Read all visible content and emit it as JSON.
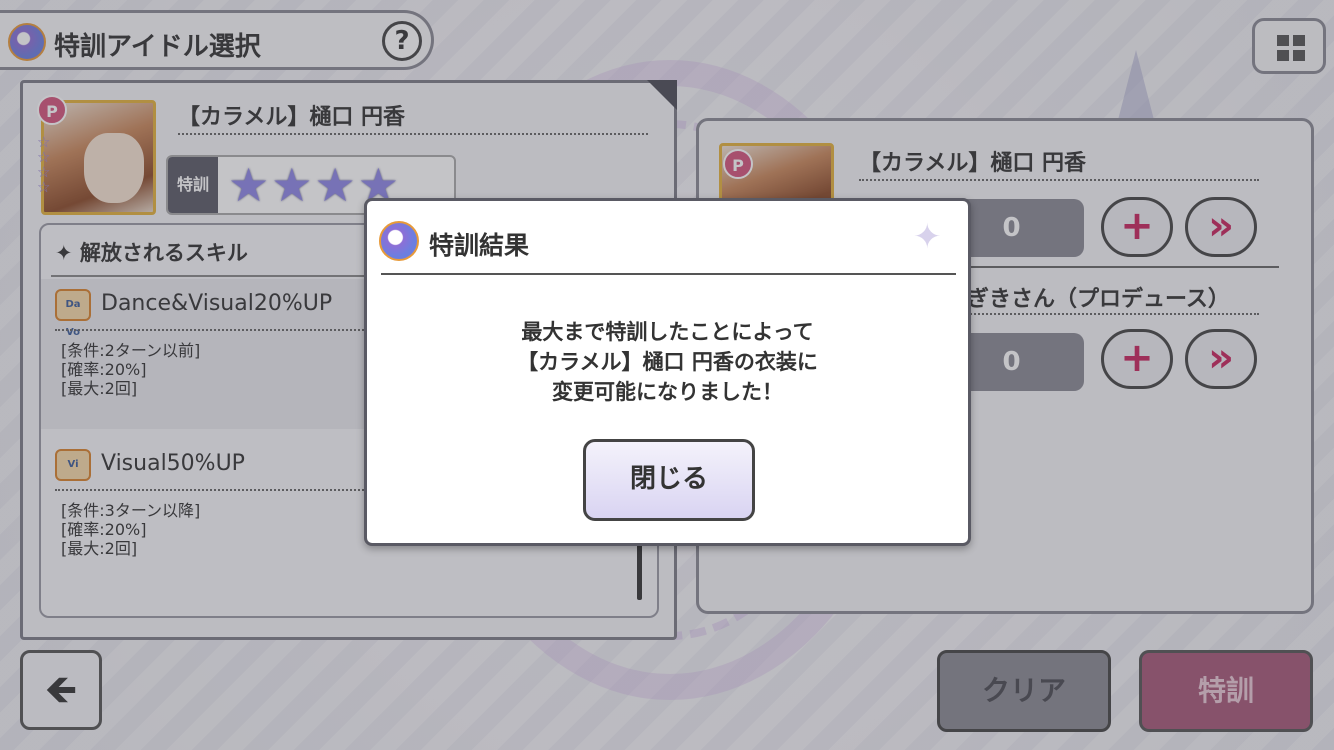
{
  "header": {
    "title": "特訓アイドル選択",
    "help_label": "?"
  },
  "left_card": {
    "name": "【カラメル】樋口 円香",
    "tokkun_label": "特訓",
    "stars": "★★★★",
    "badge": "P",
    "skills_heading": "✦ 解放されるスキル",
    "skills": [
      {
        "icon": "Da Vo",
        "name": "Dance&Visual20%UP",
        "conditions": [
          "[条件:2ターン以前]",
          "[確率:20%]",
          "[最大:2回]"
        ]
      },
      {
        "icon": "Vi",
        "name": "Visual50%UP",
        "conditions": [
          "[条件:3ターン以降]",
          "[確率:20%]",
          "[最大:2回]"
        ]
      }
    ]
  },
  "right_panel": {
    "item1_name": "【カラメル】樋口 円香",
    "item1_count": "0",
    "item2_name": "ぎきさん（プロデュース）",
    "item2_count": "0",
    "plus_label": "+",
    "max_label": "»",
    "badge": "P"
  },
  "buttons": {
    "back": "🡸",
    "clear": "クリア",
    "tokkun": "特訓"
  },
  "modal": {
    "title": "特訓結果",
    "message_lines": [
      "最大まで特訓したことによって",
      "【カラメル】樋口 円香の衣装に",
      "変更可能になりました！"
    ],
    "close_label": "閉じる"
  },
  "colors": {
    "accent_pink": "#c8245e",
    "frame_gold": "#e3b23c",
    "star_purple": "#8e86e6"
  }
}
